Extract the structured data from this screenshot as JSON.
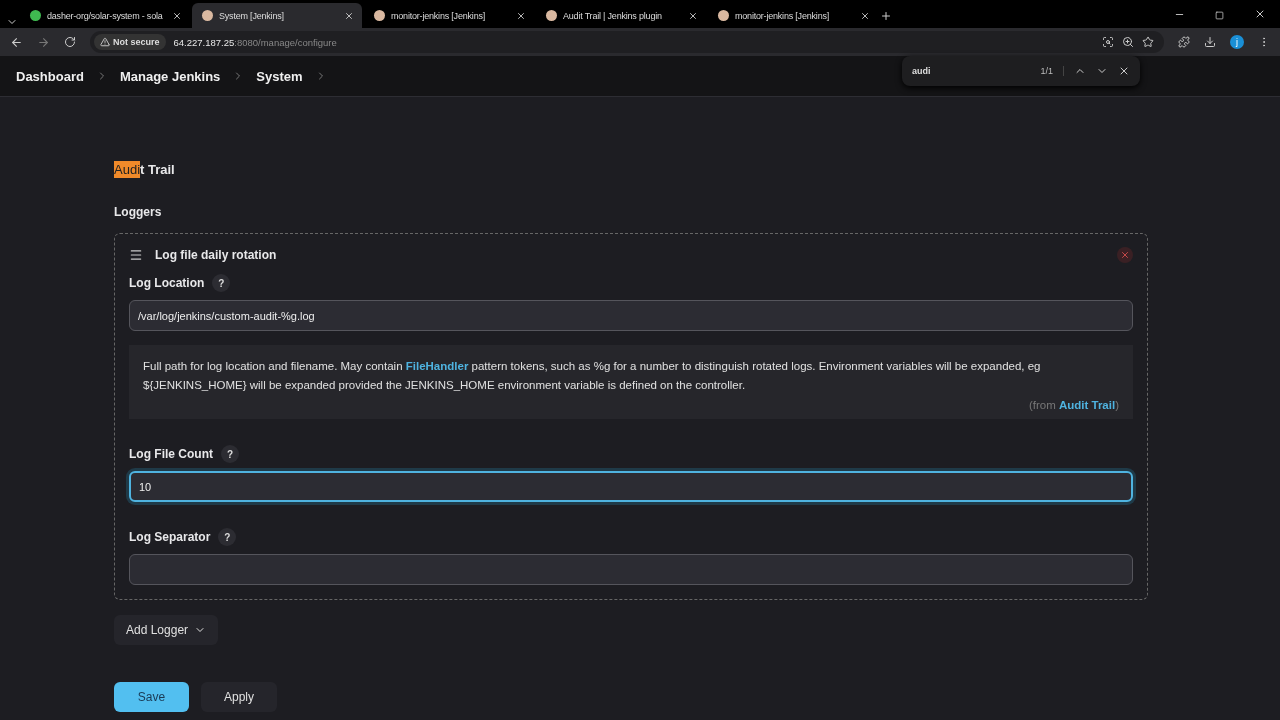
{
  "browser": {
    "tabs": [
      {
        "title": "dasher-org/solar-system - sola",
        "selected": false,
        "kind": "repo"
      },
      {
        "title": "System [Jenkins]",
        "selected": true,
        "kind": "jenkins"
      },
      {
        "title": "monitor-jenkins [Jenkins]",
        "selected": false,
        "kind": "jenkins"
      },
      {
        "title": "Audit Trail | Jenkins plugin",
        "selected": false,
        "kind": "jenkins"
      },
      {
        "title": "monitor-jenkins [Jenkins]",
        "selected": false,
        "kind": "jenkins"
      }
    ],
    "security": "Not secure",
    "url_host": "64.227.187.25",
    "url_rest": ":8080/manage/configure",
    "profile_initial": "j",
    "find": {
      "query": "audi",
      "count": "1/1"
    }
  },
  "breadcrumbs": [
    "Dashboard",
    "Manage Jenkins",
    "System"
  ],
  "section": {
    "title_highlight": "Audi",
    "title_rest": "t Trail",
    "subtitle": "Loggers"
  },
  "logger": {
    "title": "Log file daily rotation",
    "fields": [
      {
        "label": "Log Location",
        "help_mark": "?",
        "value": "/var/log/jenkins/custom-audit-%g.log",
        "focused": false,
        "help": {
          "before": "Full path for log location and filename. May contain ",
          "link": "FileHandler",
          "after": " pattern tokens, such as %g for a number to distinguish rotated logs. Environment variables will be expanded, eg ${JENKINS_HOME} will be expanded provided the JENKINS_HOME environment variable is defined on the controller.",
          "from": "(from ",
          "from_link": "Audit Trail",
          "from_end": ")"
        }
      },
      {
        "label": "Log File Count",
        "help_mark": "?",
        "value": "10",
        "focused": true
      },
      {
        "label": "Log Separator",
        "help_mark": "?",
        "focused": false
      }
    ]
  },
  "add_button": "Add Logger",
  "buttons": [
    {
      "label": "Save",
      "kind": "primary"
    },
    {
      "label": "Apply",
      "kind": "secondary"
    }
  ]
}
